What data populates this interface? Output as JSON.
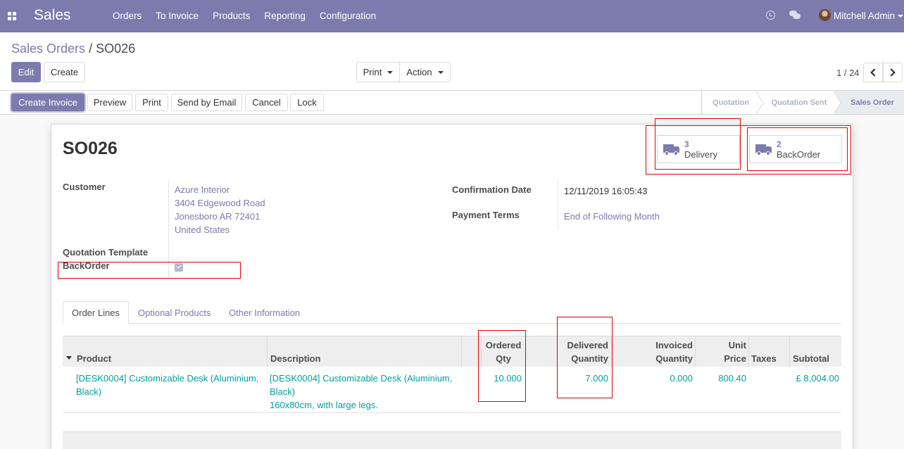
{
  "navbar": {
    "app_name": "Sales",
    "menu": [
      "Orders",
      "To Invoice",
      "Products",
      "Reporting",
      "Configuration"
    ],
    "user_name": "Mitchell Admin",
    "icons": [
      "apps-grid-icon",
      "clock-icon",
      "chat-icon"
    ]
  },
  "breadcrumb": {
    "parent": "Sales Orders",
    "separator": "/",
    "current": "SO026"
  },
  "buttons": {
    "edit": "Edit",
    "create": "Create",
    "print": "Print",
    "action": "Action"
  },
  "pager": {
    "value": "1 / 24"
  },
  "header_buttons": {
    "create_invoice": "Create Invoice",
    "preview": "Preview",
    "print": "Print",
    "send_email": "Send by Email",
    "cancel": "Cancel",
    "lock": "Lock"
  },
  "stages": [
    {
      "label": "Quotation",
      "active": false
    },
    {
      "label": "Quotation Sent",
      "active": false
    },
    {
      "label": "Sales Order",
      "active": true
    }
  ],
  "record": {
    "name": "SO026",
    "smart_buttons": [
      {
        "count": "3",
        "label": "Delivery",
        "icon": "truck-icon"
      },
      {
        "count": "2",
        "label": "BackOrder",
        "icon": "truck-icon"
      }
    ],
    "fields": {
      "customer_label": "Customer",
      "customer_lines": [
        "Azure Interior",
        "3404 Edgewood Road",
        "Jonesboro AR 72401",
        "United States"
      ],
      "quotation_template_label": "Quotation Template",
      "backorder_label": "BackOrder",
      "backorder_checked": true,
      "confirmation_date_label": "Confirmation Date",
      "confirmation_date": "12/11/2019 16:05:43",
      "payment_terms_label": "Payment Terms",
      "payment_terms": "End of Following Month"
    }
  },
  "tabs": [
    {
      "label": "Order Lines",
      "active": true
    },
    {
      "label": "Optional Products",
      "active": false
    },
    {
      "label": "Other Information",
      "active": false
    }
  ],
  "order_lines": {
    "headers": {
      "product": "Product",
      "description": "Description",
      "ordered_qty_1": "Ordered",
      "ordered_qty_2": "Qty",
      "delivered_1": "Delivered",
      "delivered_2": "Quantity",
      "invoiced_1": "Invoiced",
      "invoiced_2": "Quantity",
      "unit_price_1": "Unit",
      "unit_price_2": "Price",
      "taxes": "Taxes",
      "subtotal": "Subtotal"
    },
    "rows": [
      {
        "product_1": "[DESK0004] Customizable Desk (Aluminium,",
        "product_2": "Black)",
        "description_1": "[DESK0004] Customizable Desk (Aluminium,",
        "description_2": "Black)",
        "description_3": "160x80cm, with large legs.",
        "ordered_qty": "10.000",
        "delivered_qty": "7.000",
        "invoiced_qty": "0.000",
        "unit_price": "800.40",
        "taxes": "",
        "subtotal": "£ 8,004.00"
      }
    ]
  }
}
